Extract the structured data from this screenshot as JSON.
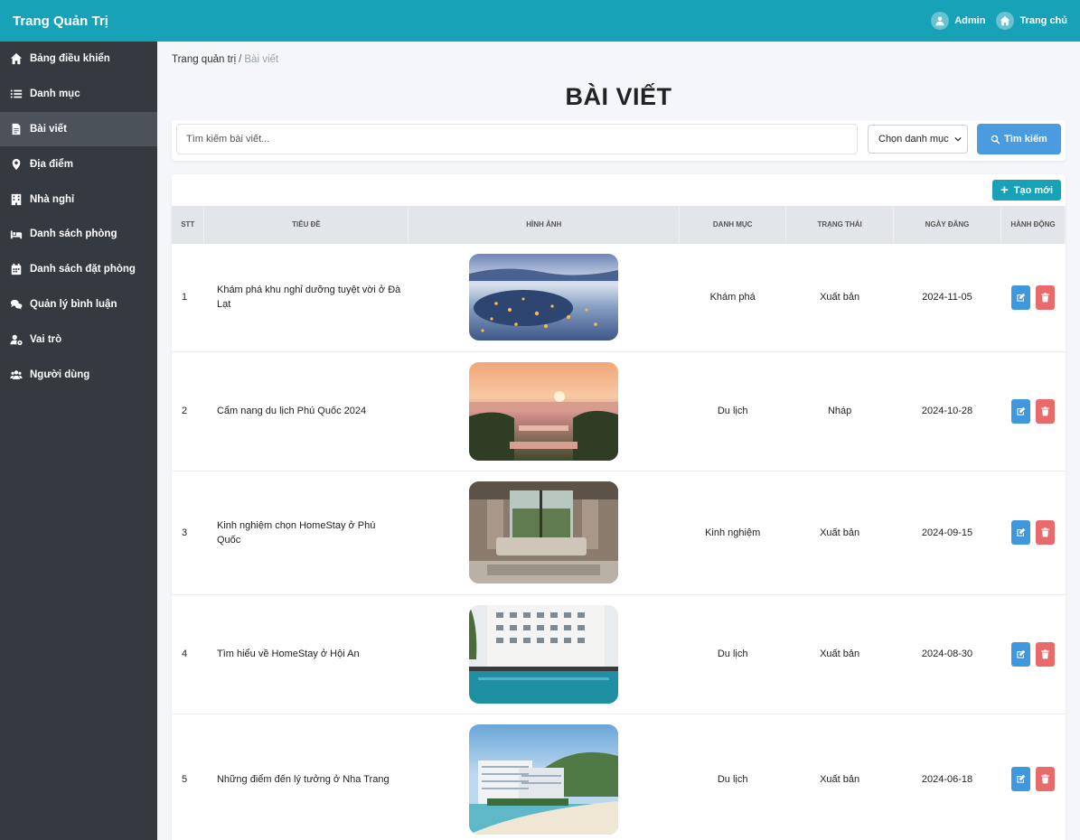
{
  "header": {
    "brand": "Trang Quản Trị",
    "admin_label": "Admin",
    "home_label": "Trang chủ"
  },
  "sidebar": {
    "items": [
      {
        "label": "Bảng điều khiển",
        "icon": "home-icon"
      },
      {
        "label": "Danh mục",
        "icon": "list-icon"
      },
      {
        "label": "Bài viết",
        "icon": "document-icon",
        "active": true
      },
      {
        "label": "Địa điểm",
        "icon": "map-pin-icon"
      },
      {
        "label": "Nhà nghỉ",
        "icon": "building-icon"
      },
      {
        "label": "Danh sách phòng",
        "icon": "bed-icon"
      },
      {
        "label": "Danh sách đặt phòng",
        "icon": "calendar-icon"
      },
      {
        "label": "Quản lý bình luận",
        "icon": "comments-icon"
      },
      {
        "label": "Vai trò",
        "icon": "user-cog-icon"
      },
      {
        "label": "Người dùng",
        "icon": "users-icon"
      }
    ]
  },
  "breadcrumb": {
    "home": "Trang quản trị",
    "separator": "/",
    "current": "Bài viết"
  },
  "page_title": "BÀI VIẾT",
  "search": {
    "placeholder": "Tìm kiếm bài viết...",
    "value": "",
    "category_selected": "Chọn danh mục",
    "button_label": "Tìm kiếm"
  },
  "toolbar": {
    "create_label": "Tạo mới"
  },
  "table": {
    "headers": [
      "STT",
      "TIÊU ĐỀ",
      "HÌNH ẢNH",
      "DANH MỤC",
      "TRẠNG THÁI",
      "NGÀY ĐĂNG",
      "HÀNH ĐỘNG"
    ],
    "rows": [
      {
        "stt": "1",
        "title": "Khám phá khu nghỉ dưỡng tuyệt vời ở Đà Lạt",
        "image": "Dalat night city with clouds",
        "category": "Khám phá",
        "status": "Xuất bản",
        "date": "2024-11-05"
      },
      {
        "stt": "2",
        "title": "Cẩm nang du lịch Phú Quốc 2024",
        "image": "Phu Quoc resort at sunset",
        "category": "Du lịch",
        "status": "Nháp",
        "date": "2024-10-28"
      },
      {
        "stt": "3",
        "title": "Kinh nghiệm chọn HomeStay ở Phú Quốc",
        "image": "Homestay living room with sofa",
        "category": "Kinh nghiệm",
        "status": "Xuất bản",
        "date": "2024-09-15"
      },
      {
        "stt": "4",
        "title": "Tìm hiểu về HomeStay ở Hội An",
        "image": "Hoi An hotel with swimming pool",
        "category": "Du lịch",
        "status": "Xuất bản",
        "date": "2024-08-30"
      },
      {
        "stt": "5",
        "title": "Những điểm đến lý tưởng ở Nha Trang",
        "image": "Nha Trang beach resort",
        "category": "Du lịch",
        "status": "Xuất bản",
        "date": "2024-06-18"
      }
    ]
  },
  "colors": {
    "topbar": "#17a2b8",
    "sidebar": "#343a40",
    "edit": "#3f97dd",
    "delete": "#e96a6a",
    "search_button": "#4a9be0"
  }
}
